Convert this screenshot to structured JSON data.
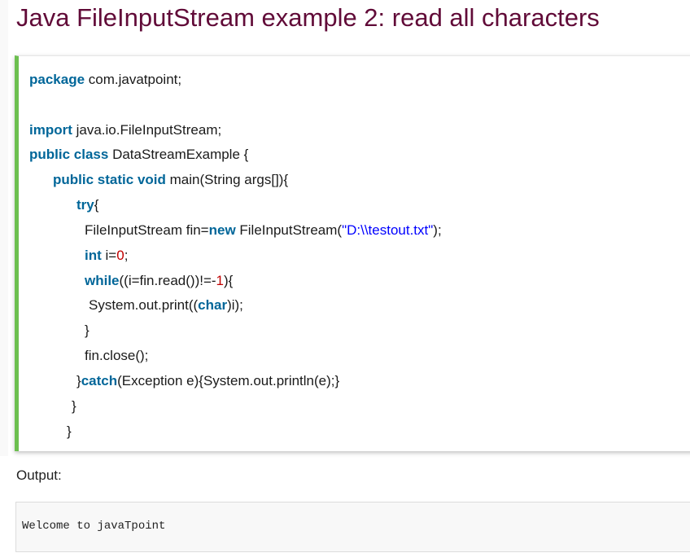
{
  "title": "Java FileInputStream example 2: read all characters",
  "code": {
    "lines": [
      [
        {
          "t": "package",
          "k": "kw"
        },
        {
          "t": " com.javatpoint;",
          "k": "plain"
        }
      ],
      [],
      [
        {
          "t": "import",
          "k": "kw"
        },
        {
          "t": " java.io.FileInputStream;",
          "k": "plain"
        }
      ],
      [
        {
          "t": "public",
          "k": "kw"
        },
        {
          "t": " ",
          "k": "plain"
        },
        {
          "t": "class",
          "k": "kw"
        },
        {
          "t": " DataStreamExample {",
          "k": "plain"
        }
      ],
      [
        {
          "t": "public",
          "k": "kw"
        },
        {
          "t": " ",
          "k": "plain"
        },
        {
          "t": "static",
          "k": "kw"
        },
        {
          "t": " ",
          "k": "plain"
        },
        {
          "t": "void",
          "k": "kw"
        },
        {
          "t": " main(String args[]){",
          "k": "plain"
        }
      ],
      [
        {
          "t": "try",
          "k": "kw"
        },
        {
          "t": "{",
          "k": "plain"
        }
      ],
      [
        {
          "t": "FileInputStream fin=",
          "k": "plain"
        },
        {
          "t": "new",
          "k": "kw"
        },
        {
          "t": " FileInputStream(",
          "k": "plain"
        },
        {
          "t": "\"D:\\\\testout.txt\"",
          "k": "str"
        },
        {
          "t": ");",
          "k": "plain"
        }
      ],
      [
        {
          "t": "int",
          "k": "kw"
        },
        {
          "t": " i=",
          "k": "plain"
        },
        {
          "t": "0",
          "k": "num"
        },
        {
          "t": ";",
          "k": "plain"
        }
      ],
      [
        {
          "t": "while",
          "k": "kw"
        },
        {
          "t": "((i=fin.read())!=-",
          "k": "plain"
        },
        {
          "t": "1",
          "k": "num"
        },
        {
          "t": "){",
          "k": "plain"
        }
      ],
      [
        {
          "t": "System.out.print((",
          "k": "plain"
        },
        {
          "t": "char",
          "k": "kw"
        },
        {
          "t": ")i);",
          "k": "plain"
        }
      ],
      [
        {
          "t": "}",
          "k": "plain"
        }
      ],
      [
        {
          "t": "fin.close();",
          "k": "plain"
        }
      ],
      [
        {
          "t": "}",
          "k": "plain"
        },
        {
          "t": "catch",
          "k": "kw"
        },
        {
          "t": "(Exception e){System.out.println(e);}",
          "k": "plain"
        }
      ],
      [
        {
          "t": "}",
          "k": "plain"
        }
      ],
      [
        {
          "t": "}",
          "k": "plain"
        }
      ]
    ]
  },
  "output": {
    "label": "Output:",
    "text": "Welcome to javaTpoint"
  }
}
